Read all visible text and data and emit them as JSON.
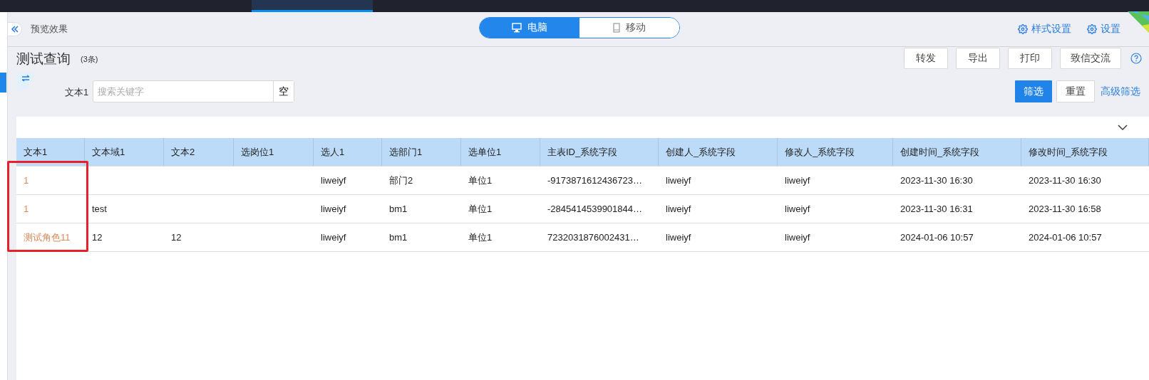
{
  "header": {
    "title": "预览效果",
    "device_tabs": [
      {
        "label": "电脑",
        "kind": "desktop",
        "selected": true
      },
      {
        "label": "移动",
        "kind": "mobile",
        "selected": false
      }
    ],
    "links": [
      "样式设置",
      "设置"
    ]
  },
  "page": {
    "title": "测试查询",
    "count": "(3条)",
    "actions": [
      "转发",
      "导出",
      "打印",
      "致信交流"
    ]
  },
  "filter": {
    "label": "文本1",
    "placeholder": "搜索关键字",
    "clear": "空",
    "buttons": [
      {
        "label": "筛选",
        "kind": "primary"
      },
      {
        "label": "重置",
        "kind": "default"
      },
      {
        "label": "高级筛选",
        "kind": "link"
      }
    ]
  },
  "table": {
    "columns": [
      "文本1",
      "文本域1",
      "文本2",
      "选岗位1",
      "选人1",
      "选部门1",
      "选单位1",
      "主表ID_系统字段",
      "创建人_系统字段",
      "修改人_系统字段",
      "创建时间_系统字段",
      "修改时间_系统字段"
    ],
    "rows": [
      [
        "1",
        "",
        "",
        "",
        "liweiyf",
        "部门2",
        "单位1",
        "-9173871612436723…",
        "liweiyf",
        "liweiyf",
        "2023-11-30 16:30",
        "2023-11-30 16:30"
      ],
      [
        "1",
        "test",
        "",
        "",
        "liweiyf",
        "bm1",
        "单位1",
        "-2845414539901844…",
        "liweiyf",
        "liweiyf",
        "2023-11-30 16:31",
        "2023-11-30 16:58"
      ],
      [
        "测试角色11",
        "12",
        "12",
        "",
        "liweiyf",
        "bm1",
        "单位1",
        "7232031876002431…",
        "liweiyf",
        "liweiyf",
        "2024-01-06 10:57",
        "2024-01-06 10:57"
      ]
    ]
  }
}
